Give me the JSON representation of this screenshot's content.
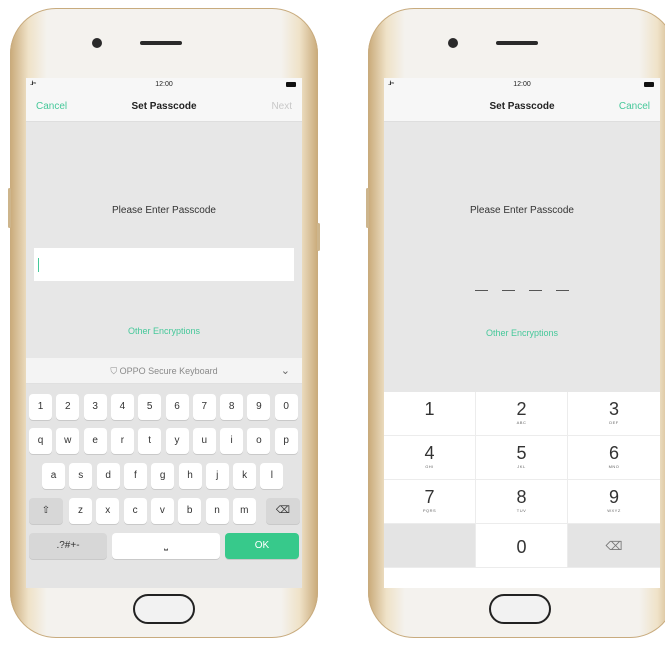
{
  "left_phone": {
    "status": {
      "signal": "..ıl ≈",
      "time": "12:00"
    },
    "nav": {
      "left": "Cancel",
      "title": "Set Passcode",
      "right": "Next"
    },
    "prompt": "Please Enter Passcode",
    "other_encryptions": "Other Encryptions",
    "keyboard_label": "OPPO Secure Keyboard",
    "keyboard": {
      "row1": [
        "1",
        "2",
        "3",
        "4",
        "5",
        "6",
        "7",
        "8",
        "9",
        "0"
      ],
      "row2": [
        "q",
        "w",
        "e",
        "r",
        "t",
        "y",
        "u",
        "i",
        "o",
        "p"
      ],
      "row3": [
        "a",
        "s",
        "d",
        "f",
        "g",
        "h",
        "j",
        "k",
        "l"
      ],
      "row4": [
        "z",
        "x",
        "c",
        "v",
        "b",
        "n",
        "m"
      ],
      "shift": "⇧",
      "backspace": "⌫",
      "symbols": ".?#+-",
      "space": "⎵",
      "ok": "OK"
    }
  },
  "right_phone": {
    "status": {
      "signal": "..ıl ≈",
      "time": "12:00"
    },
    "nav": {
      "title": "Set Passcode",
      "right": "Cancel"
    },
    "prompt": "Please Enter Passcode",
    "other_encryptions": "Other Encryptions",
    "keypad": [
      {
        "digit": "1",
        "letters": ""
      },
      {
        "digit": "2",
        "letters": "ABC"
      },
      {
        "digit": "3",
        "letters": "DEF"
      },
      {
        "digit": "4",
        "letters": "GHI"
      },
      {
        "digit": "5",
        "letters": "JKL"
      },
      {
        "digit": "6",
        "letters": "MNO"
      },
      {
        "digit": "7",
        "letters": "PQRS"
      },
      {
        "digit": "8",
        "letters": "TUV"
      },
      {
        "digit": "9",
        "letters": "WXYZ"
      }
    ],
    "zero": "0",
    "delete": "⌫"
  },
  "colors": {
    "accent": "#46c89a",
    "ok_key": "#37c98b",
    "gold_frame": "#c9a978"
  }
}
